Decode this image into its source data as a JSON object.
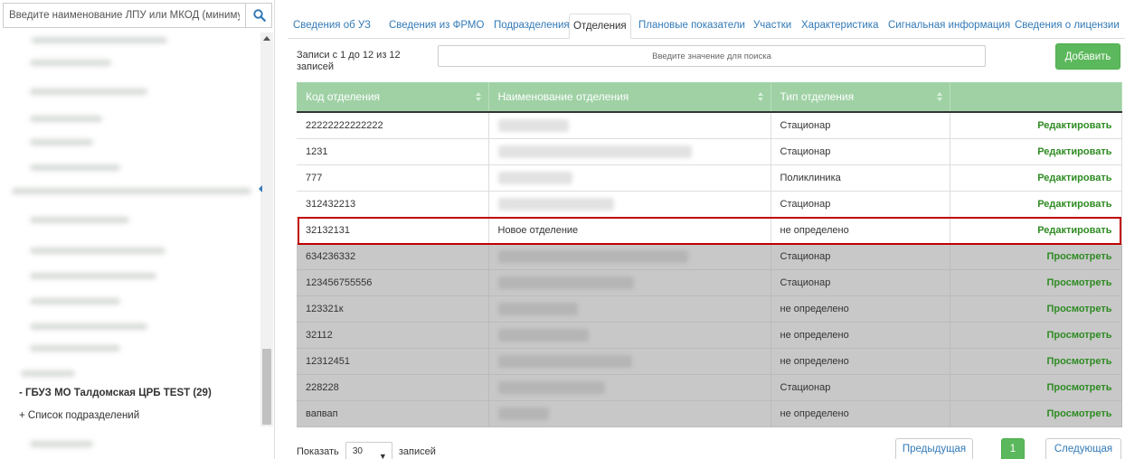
{
  "left_panel": {
    "search": {
      "placeholder": "Введите наименование ЛПУ или МКОД (минимум"
    },
    "tree": {
      "org_node": "- ГБУЗ МО Талдомская ЦРБ TEST (29)",
      "sub_node": "+ Список подразделений"
    }
  },
  "tabs": [
    "Сведения об УЗ",
    "Сведения из ФРМО",
    "Подразделения",
    "Отделения",
    "Плановые показатели",
    "Участки",
    "Характеристика",
    "Сигнальная информация",
    "Сведения о лицензии"
  ],
  "active_tab": "Отделения",
  "toolbar": {
    "records_info": "Записи с 1 до 12 из 12 записей",
    "filter_placeholder": "Введите значение для поиска",
    "add_label": "Добавить"
  },
  "table": {
    "columns": [
      "Код отделения",
      "Наименование отделения",
      "Тип отделения",
      ""
    ],
    "rows": [
      {
        "code": "22222222222222",
        "name": "",
        "type": "Стационар",
        "action": "Редактировать"
      },
      {
        "code": "1231",
        "name": "",
        "type": "Стационар",
        "action": "Редактировать"
      },
      {
        "code": "777",
        "name": "",
        "type": "Поликлиника",
        "action": "Редактировать"
      },
      {
        "code": "312432213",
        "name": "",
        "type": "Стационар",
        "action": "Редактировать"
      },
      {
        "code": "32132131",
        "name": "Новое отделение",
        "type": "не определено",
        "action": "Редактировать"
      },
      {
        "code": "634236332",
        "name": "",
        "type": "Стационар",
        "action": "Просмотреть"
      },
      {
        "code": "123456755556",
        "name": "",
        "type": "Стационар",
        "action": "Просмотреть"
      },
      {
        "code": "123321к",
        "name": "",
        "type": "не определено",
        "action": "Просмотреть"
      },
      {
        "code": "32112",
        "name": "",
        "type": "не определено",
        "action": "Просмотреть"
      },
      {
        "code": "12312451",
        "name": "",
        "type": "не определено",
        "action": "Просмотреть"
      },
      {
        "code": "228228",
        "name": "",
        "type": "Стационар",
        "action": "Просмотреть"
      },
      {
        "code": "вапвап",
        "name": "",
        "type": "не определено",
        "action": "Просмотреть"
      }
    ]
  },
  "footer": {
    "show_label": "Показать",
    "page_size": "30",
    "records_label": "записей",
    "prev_label": "Предыдущая",
    "current_page": "1",
    "next_label": "Следующая"
  },
  "icons": {
    "search": "magnifier-icon",
    "dropdown": "chevron-down-icon",
    "sort": "sort-icon"
  },
  "colors": {
    "header_bg": "#9fd1a5",
    "accent_green": "#5cb85c",
    "action_text": "#2e8b22",
    "link_blue": "#337ab7",
    "highlight_border": "#c00000",
    "readonly_row": "#c8c8c8"
  }
}
